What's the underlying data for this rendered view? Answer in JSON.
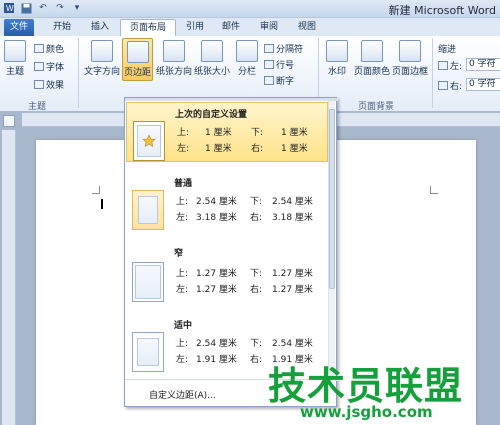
{
  "window": {
    "title": "新建 Microsoft Word"
  },
  "tabs": [
    "文件",
    "开始",
    "插入",
    "页面布局",
    "引用",
    "邮件",
    "审阅",
    "视图"
  ],
  "active_tab": "页面布局",
  "ribbon": {
    "theme_group": {
      "label": "主题",
      "buttons": {
        "themes": "主题",
        "colors": "颜色",
        "fonts": "字体",
        "effects": "效果"
      }
    },
    "page_setup": {
      "text_direction": "文字方向",
      "margins": "页边距",
      "orientation": "纸张方向",
      "size": "纸张大小",
      "columns": "分栏",
      "breaks": "分隔符",
      "line_numbers": "行号",
      "hyphenation": "断字"
    },
    "page_background": {
      "label": "页面背景",
      "watermark": "水印",
      "page_color": "页面颜色",
      "page_borders": "页面边框"
    },
    "paragraph": {
      "indent_label": "缩进",
      "left_label": "左:",
      "left_value": "0 字符",
      "right_label": "右:",
      "right_value": "0 字符"
    }
  },
  "margins_menu": {
    "presets": [
      {
        "name": "上次的自定义设置",
        "highlighted": true,
        "top_label": "上:",
        "top": "1 厘米",
        "bottom_label": "下:",
        "bottom": "1 厘米",
        "left_label": "左:",
        "left": "1 厘米",
        "right_label": "右:",
        "right": "1 厘米"
      },
      {
        "name": "普通",
        "highlighted": false,
        "top_label": "上:",
        "top": "2.54 厘米",
        "bottom_label": "下:",
        "bottom": "2.54 厘米",
        "left_label": "左:",
        "left": "3.18 厘米",
        "right_label": "右:",
        "right": "3.18 厘米"
      },
      {
        "name": "窄",
        "highlighted": false,
        "top_label": "上:",
        "top": "1.27 厘米",
        "bottom_label": "下:",
        "bottom": "1.27 厘米",
        "left_label": "左:",
        "left": "1.27 厘米",
        "right_label": "右:",
        "right": "1.27 厘米"
      },
      {
        "name": "适中",
        "highlighted": false,
        "top_label": "上:",
        "top": "2.54 厘米",
        "bottom_label": "下:",
        "bottom": "2.54 厘米",
        "left_label": "左:",
        "left": "1.91 厘米",
        "right_label": "右:",
        "right": "1.91 厘米"
      }
    ],
    "custom_label": "自定义边距(A)..."
  },
  "watermark": {
    "title": "技术员联盟",
    "url": "www.jsgho.com"
  },
  "colors": {
    "accent": "#2a5ea8",
    "highlight": "#ffe38a",
    "watermark": "#15a03b"
  }
}
